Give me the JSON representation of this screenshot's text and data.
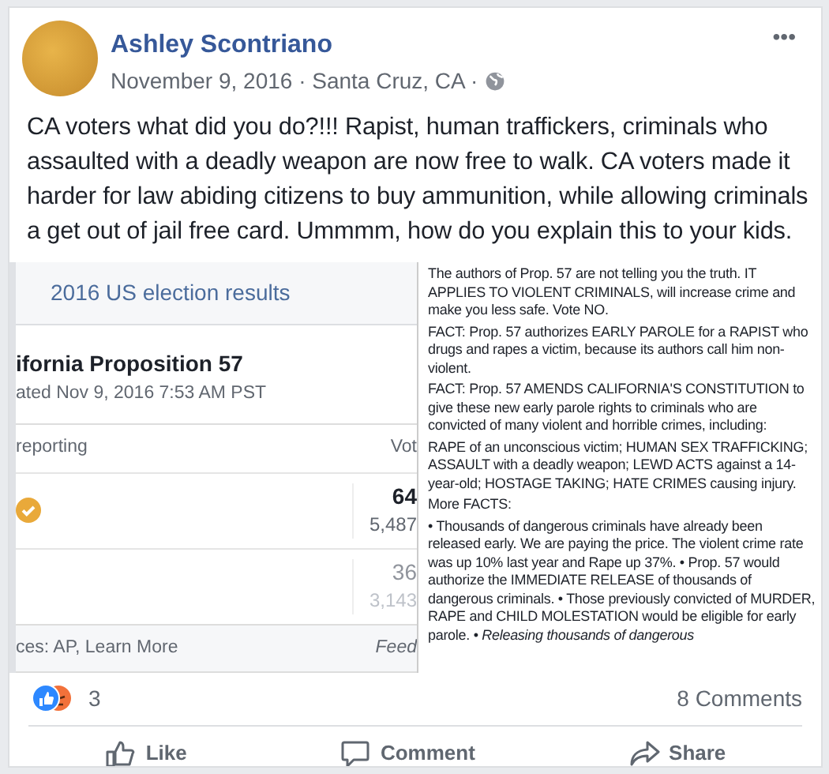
{
  "post": {
    "author": "Ashley Scontriano",
    "meta": "November 9, 2016 · Santa Cruz, CA ·",
    "menu": "•••",
    "text": "CA voters what did you do?!!! Rapist, human traffickers, criminals who assaulted with a deadly weapon are now free to walk. CA voters made it harder for law abiding citizens to buy ammunition, while allowing criminals a get out of jail free card. Ummmm, how do you explain this to your kids."
  },
  "election_widget": {
    "header": "2016 US election results",
    "title": "ifornia Proposition 57",
    "updated": "ated Nov 9, 2016 7:53 AM PST",
    "column_1": "reporting",
    "column_2": "Vot",
    "rows": [
      {
        "winner": true,
        "percent": "64",
        "votes": "5,487"
      },
      {
        "winner": false,
        "percent": "36",
        "votes": "3,143"
      }
    ],
    "footer_left": "ces: AP, Learn More",
    "footer_right": "Feed"
  },
  "overlay": {
    "paragraphs": [
      "The authors of Prop. 57 are not telling you the truth. IT APPLIES TO VIOLENT CRIMINALS, will increase crime and make you less safe. Vote NO.",
      "FACT: Prop. 57 authorizes EARLY PAROLE for a RAPIST who drugs and rapes a victim, because its authors call him non-violent.",
      "FACT: Prop. 57 AMENDS CALIFORNIA'S CONSTITUTION to give these new early parole rights to criminals who are convicted of many violent and horrible crimes, including:",
      "RAPE of an unconscious victim; HUMAN SEX TRAFFICKING; ASSAULT with a deadly weapon; LEWD ACTS against a 14-year-old; HOSTAGE TAKING; HATE CRIMES causing injury.",
      "More FACTS:",
      "• Thousands of dangerous criminals have already been released early. We are paying the price. The violent crime rate was up 10% last year and Rape up 37%. • Prop. 57 would authorize the IMMEDIATE RELEASE of thousands of dangerous criminals. • Those previously convicted of MURDER, RAPE and CHILD MOLESTATION would be eligible for early parole. • *Releasing thousands of dangerous*"
    ]
  },
  "reactions": {
    "count": "3"
  },
  "comments": "8 Comments",
  "actions": [
    {
      "kind": "like",
      "label": "Like"
    },
    {
      "kind": "comment",
      "label": "Comment"
    },
    {
      "kind": "share",
      "label": "Share"
    }
  ]
}
